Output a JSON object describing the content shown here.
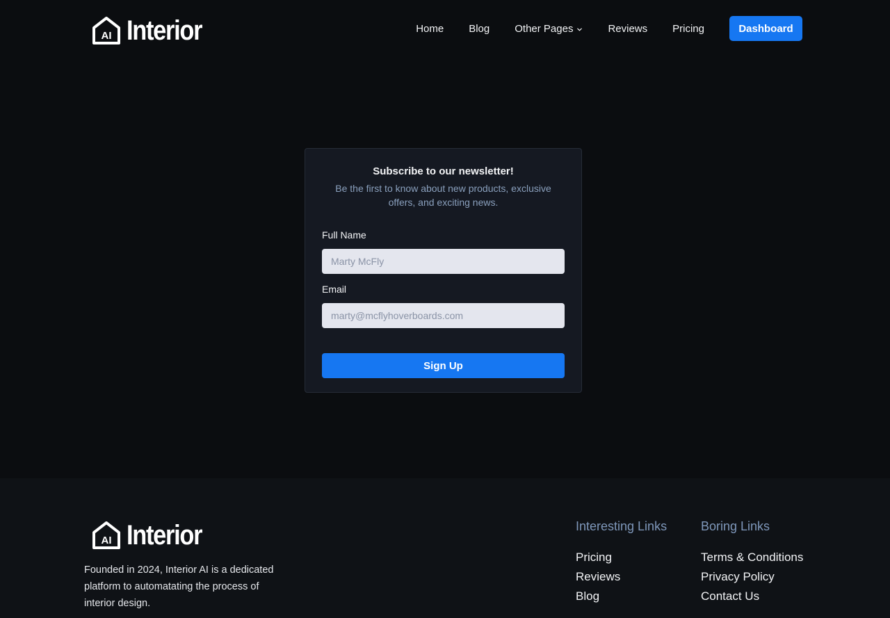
{
  "brand": {
    "logo_badge": "AI",
    "name": "Interior"
  },
  "nav": {
    "items": [
      {
        "label": "Home"
      },
      {
        "label": "Blog"
      },
      {
        "label": "Other Pages",
        "has_dropdown": true
      },
      {
        "label": "Reviews"
      },
      {
        "label": "Pricing"
      }
    ],
    "dashboard_label": "Dashboard"
  },
  "newsletter": {
    "title": "Subscribe to our newsletter!",
    "subtitle": "Be the first to know about new products, exclusive offers, and exciting news.",
    "full_name": {
      "label": "Full Name",
      "placeholder": "Marty McFly",
      "value": ""
    },
    "email": {
      "label": "Email",
      "placeholder": "marty@mcflyhoverboards.com",
      "value": ""
    },
    "submit_label": "Sign Up"
  },
  "footer": {
    "description": "Founded in 2024, Interior AI is a dedicated platform to automatating the process of interior design.",
    "interesting_links": {
      "title": "Interesting Links",
      "items": [
        "Pricing",
        "Reviews",
        "Blog"
      ]
    },
    "boring_links": {
      "title": "Boring Links",
      "items": [
        "Terms & Conditions",
        "Privacy Policy",
        "Contact Us"
      ]
    }
  },
  "colors": {
    "background": "#0b0d10",
    "accent": "#1677f2",
    "card": "#151922",
    "footer": "#0f1216",
    "muted_text": "#8aa0bd"
  }
}
